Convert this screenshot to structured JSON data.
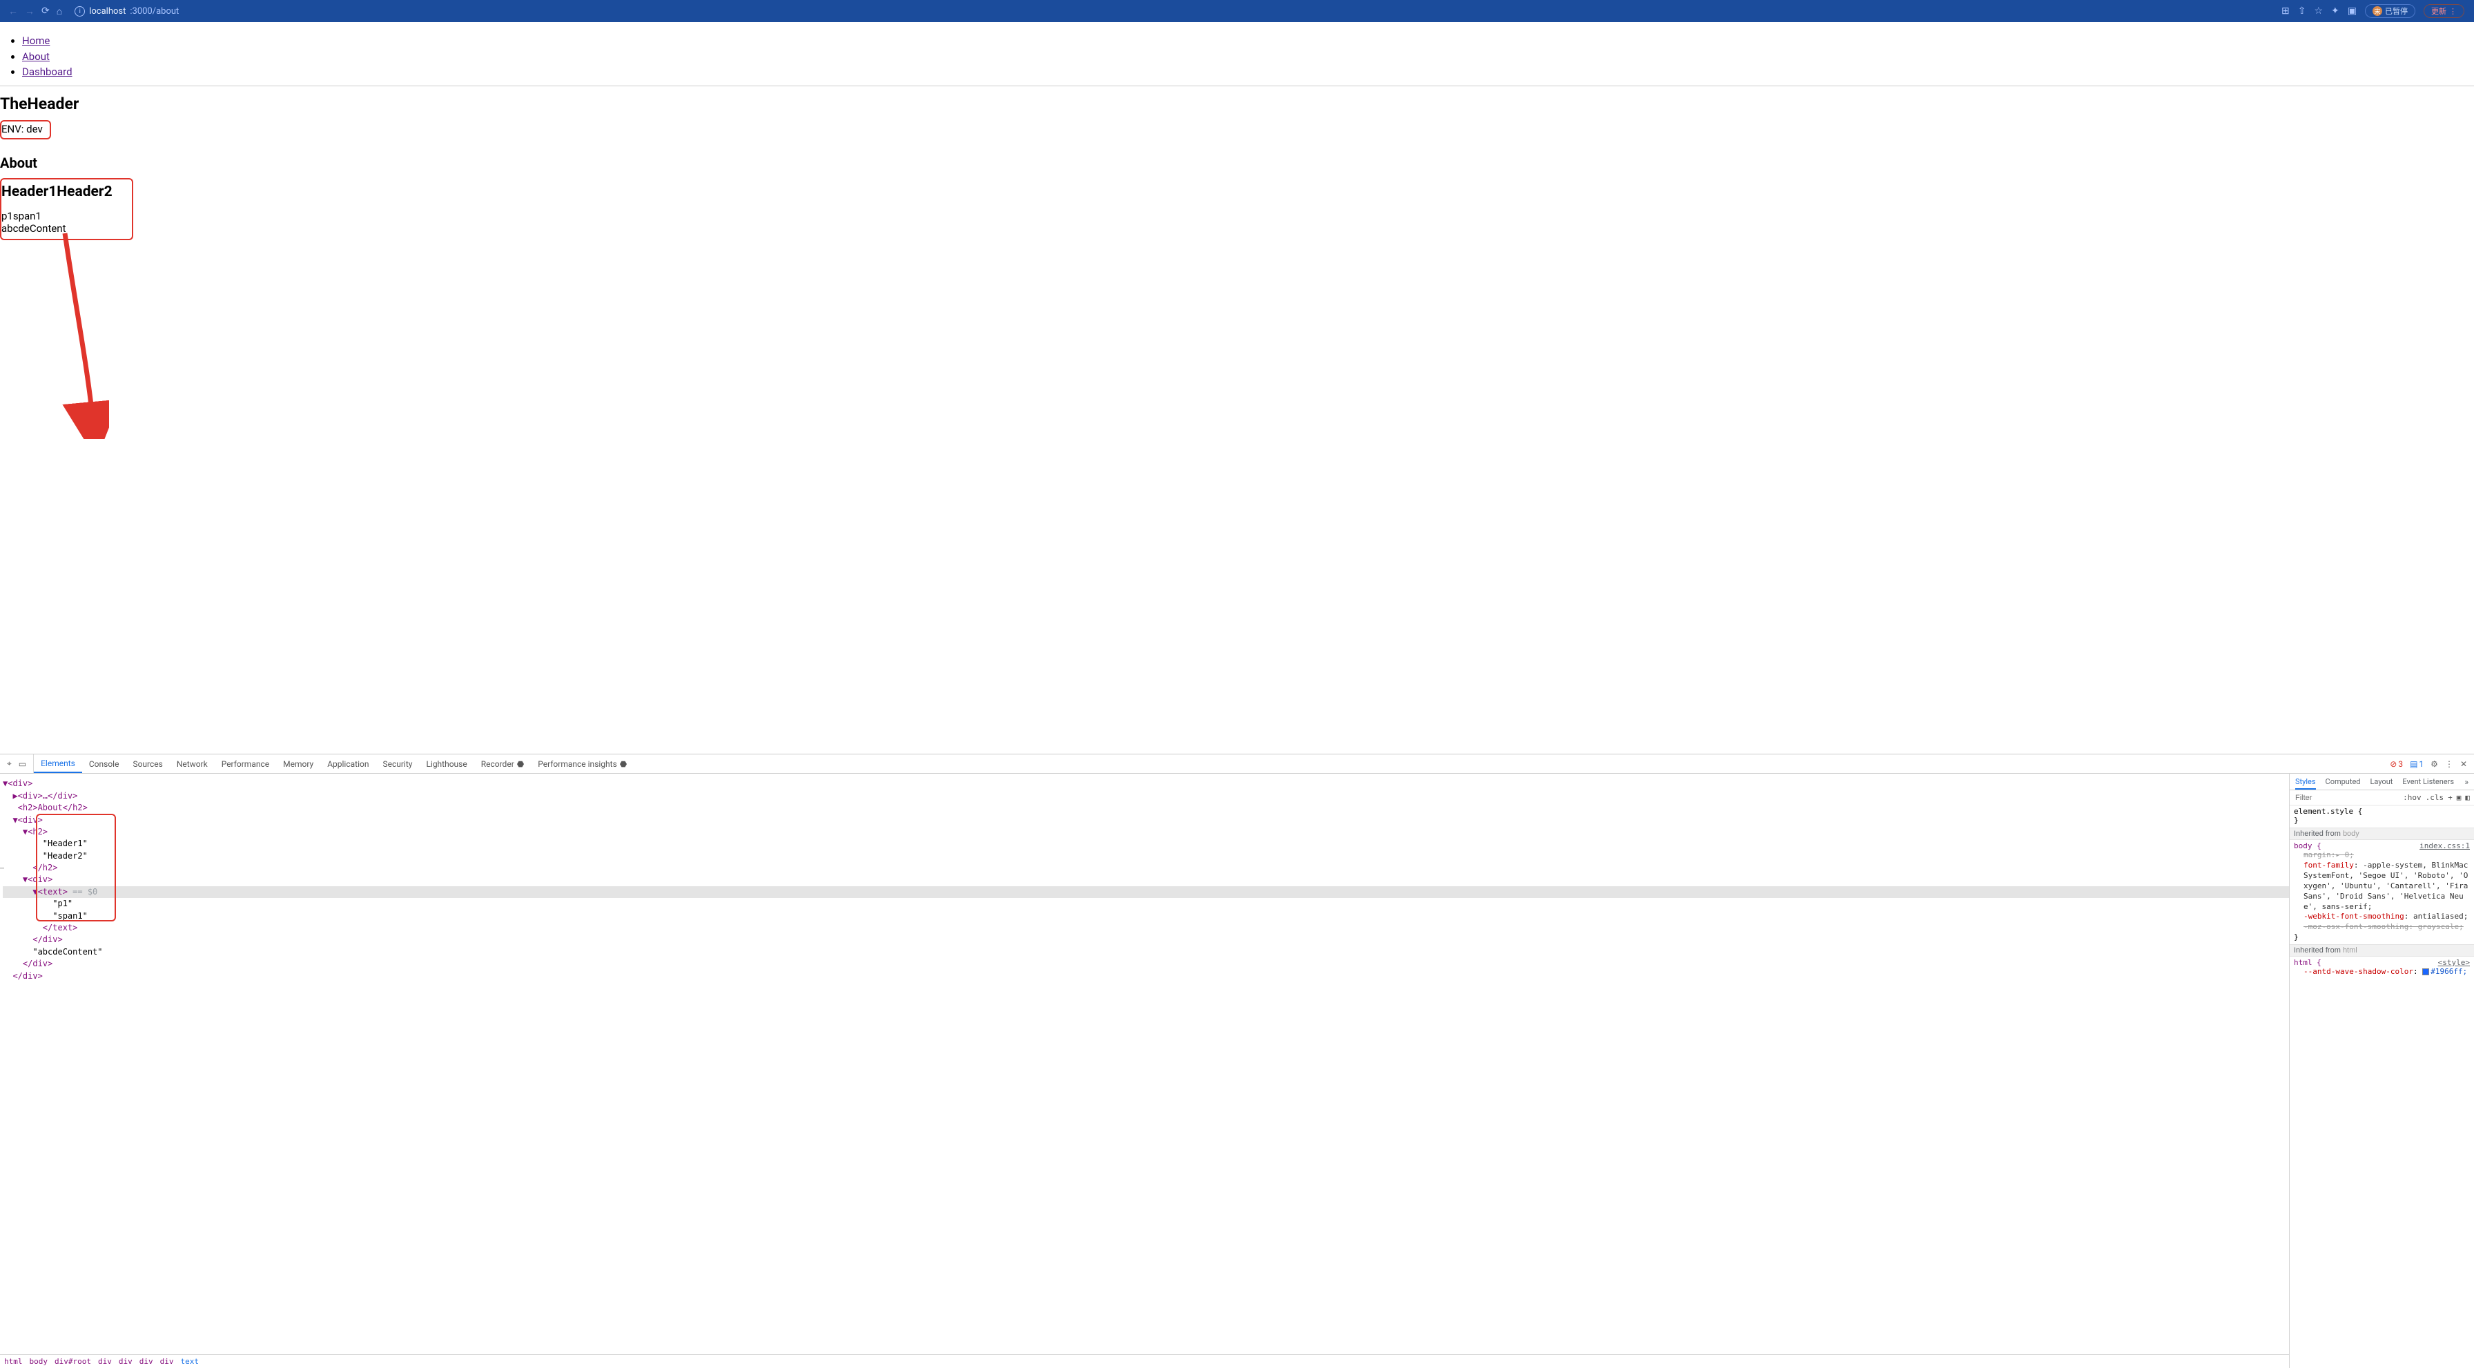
{
  "browser": {
    "url_host": "localhost",
    "url_port_path": ":3000/about",
    "pill_pause": "已暂停",
    "pill_pause_avatar": "宋",
    "pill_update": "更新",
    "icons": {
      "translate": "⊞",
      "share": "⇧",
      "star": "☆",
      "puzzle": "✦",
      "panel": "▣"
    }
  },
  "page": {
    "nav": [
      "Home",
      "About",
      "Dashboard"
    ],
    "the_header": "TheHeader",
    "env_line": "ENV: dev",
    "about": "About",
    "h1h2": "Header1Header2",
    "p1span1": "p1span1",
    "abcde": "abcdeContent"
  },
  "devtools": {
    "tabs": [
      "Elements",
      "Console",
      "Sources",
      "Network",
      "Performance",
      "Memory",
      "Application",
      "Security",
      "Lighthouse",
      "Recorder",
      "Performance insights"
    ],
    "error_count": "3",
    "info_count": "1",
    "styles_tabs": [
      "Styles",
      "Computed",
      "Layout",
      "Event Listeners"
    ],
    "filter_placeholder": "Filter",
    "hov": ":hov",
    "cls": ".cls",
    "element_style": "element.style {",
    "brace_close": "}",
    "inherit_body": "Inherited from",
    "inherit_body_kw": "body",
    "inherit_html_kw": "html",
    "body_sel": "body {",
    "index_css": "index.css:1",
    "style_tag": "<style>",
    "margin_prop": "margin",
    "margin_val": ":▸ 0;",
    "ff_prop": "font-family",
    "ff_val": ": -apple-system, BlinkMacSystemFont, 'Segoe UI', 'Roboto', 'Oxygen', 'Ubuntu', 'Cantarell', 'Fira Sans', 'Droid Sans', 'Helvetica Neue', sans-serif;",
    "wfs_prop": "-webkit-font-smoothing",
    "wfs_val": ": antialiased;",
    "moz_line": "-moz-osx-font-smoothing: grayscale;",
    "html_sel": "html {",
    "antd_prop": "--antd-wave-shadow-color",
    "antd_val": "#1966ff;",
    "dom_lines": {
      "l1": "▼<div>",
      "l2": "  ▶<div>…</div>",
      "l3": "   <h2>About</h2>",
      "l4": "  ▼<div>",
      "l5": "    ▼<h2>",
      "l6": "        \"Header1\"",
      "l7": "        \"Header2\"",
      "l8": "      </h2>",
      "l9": "    ▼<div>",
      "l10_a": "      ▼<text>",
      "l10_b": " == $0",
      "l11": "          \"p1\"",
      "l12": "          \"span1\"",
      "l13": "        </text>",
      "l14": "      </div>",
      "l15": "      \"abcdeContent\"",
      "l16": "    </div>",
      "l17": "  </div>"
    },
    "crumb": [
      "html",
      "body",
      "div#root",
      "div",
      "div",
      "div",
      "div",
      "text"
    ]
  }
}
